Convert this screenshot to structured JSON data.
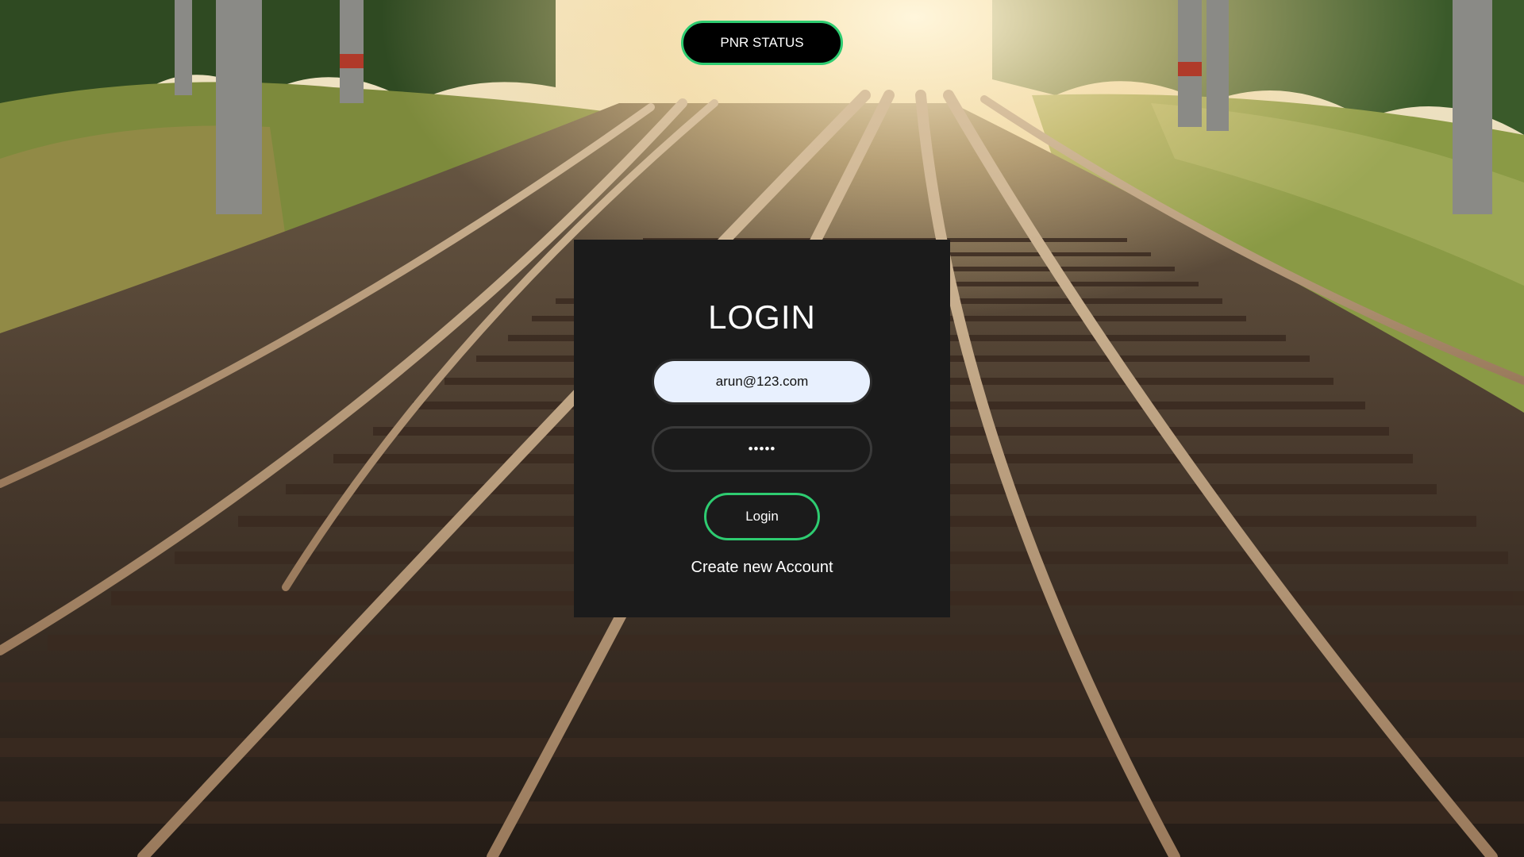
{
  "header": {
    "pnr_status_label": "PNR STATUS"
  },
  "login": {
    "title": "LOGIN",
    "email_value": "arun@123.com",
    "password_value": "•••••",
    "login_button_label": "Login",
    "create_account_label": "Create new Account"
  },
  "colors": {
    "accent": "#2ecc71",
    "card_background": "#1b1b1b",
    "email_field_background": "#e8f0fe"
  },
  "background": {
    "icon": "railway-tracks-photo"
  }
}
